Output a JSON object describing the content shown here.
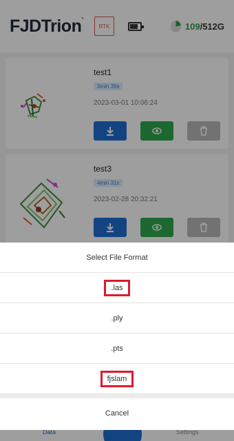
{
  "header": {
    "brand": "FJDTrion",
    "trademark": "°",
    "rtk_label": "RTK",
    "storage_used": "109",
    "storage_total": "/512G"
  },
  "cards": [
    {
      "title": "test1",
      "duration": "3min 39s",
      "datetime": "2023-03-01 10:06:24"
    },
    {
      "title": "test3",
      "duration": "4min 31s",
      "datetime": "2023-02-28 20:32:21"
    }
  ],
  "bottom_nav": {
    "data_label": "Data",
    "settings_label": "Settings"
  },
  "sheet": {
    "title": "Select File Format",
    "options": [
      ".las",
      ".ply",
      ".pts",
      "fjslam"
    ],
    "cancel_label": "Cancel"
  },
  "colors": {
    "download": "#1f6fd1",
    "view": "#2fa84f",
    "delete": "#b9b9b9",
    "highlight": "#e0182d",
    "storage": "#2e9e4a"
  },
  "icons": [
    "battery-icon",
    "storage-pie-icon",
    "download-icon",
    "eye-icon",
    "trash-icon"
  ]
}
